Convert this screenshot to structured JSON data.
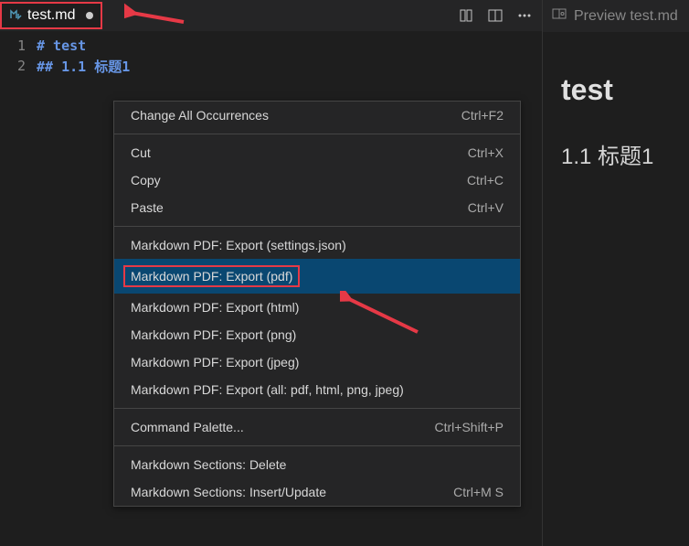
{
  "editor": {
    "tab": {
      "filename": "test.md",
      "dirty": true
    },
    "lines": [
      {
        "num": "1",
        "content": "# test"
      },
      {
        "num": "2",
        "content": "## 1.1 标题1"
      }
    ]
  },
  "contextMenu": {
    "groups": [
      [
        {
          "label": "Change All Occurrences",
          "shortcut": "Ctrl+F2",
          "highlighted": false
        }
      ],
      [
        {
          "label": "Cut",
          "shortcut": "Ctrl+X",
          "highlighted": false
        },
        {
          "label": "Copy",
          "shortcut": "Ctrl+C",
          "highlighted": false
        },
        {
          "label": "Paste",
          "shortcut": "Ctrl+V",
          "highlighted": false
        }
      ],
      [
        {
          "label": "Markdown PDF: Export (settings.json)",
          "shortcut": "",
          "highlighted": false
        },
        {
          "label": "Markdown PDF: Export (pdf)",
          "shortcut": "",
          "highlighted": true
        },
        {
          "label": "Markdown PDF: Export (html)",
          "shortcut": "",
          "highlighted": false
        },
        {
          "label": "Markdown PDF: Export (png)",
          "shortcut": "",
          "highlighted": false
        },
        {
          "label": "Markdown PDF: Export (jpeg)",
          "shortcut": "",
          "highlighted": false
        },
        {
          "label": "Markdown PDF: Export (all: pdf, html, png, jpeg)",
          "shortcut": "",
          "highlighted": false
        }
      ],
      [
        {
          "label": "Command Palette...",
          "shortcut": "Ctrl+Shift+P",
          "highlighted": false
        }
      ],
      [
        {
          "label": "Markdown Sections: Delete",
          "shortcut": "",
          "highlighted": false
        },
        {
          "label": "Markdown Sections: Insert/Update",
          "shortcut": "Ctrl+M S",
          "highlighted": false
        }
      ]
    ]
  },
  "preview": {
    "tabLabel": "Preview test.md",
    "h1": "test",
    "h2": "1.1 标题1"
  },
  "annotations": {
    "arrowColor": "#e63946"
  }
}
